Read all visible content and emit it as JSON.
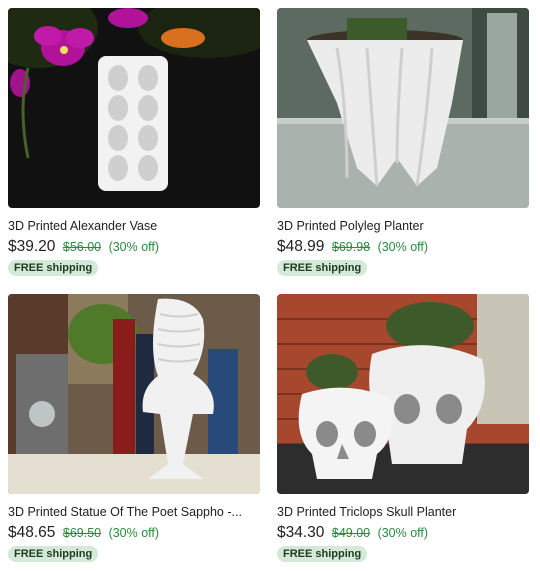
{
  "listings": [
    {
      "title": "3D Printed Alexander Vase",
      "price": "$39.20",
      "original_price": "$56.00",
      "discount": "(30% off)",
      "shipping_badge": "FREE shipping"
    },
    {
      "title": "3D Printed Polyleg Planter",
      "price": "$48.99",
      "original_price": "$69.98",
      "discount": "(30% off)",
      "shipping_badge": "FREE shipping"
    },
    {
      "title": "3D Printed Statue Of The Poet Sappho -...",
      "price": "$48.65",
      "original_price": "$69.50",
      "discount": "(30% off)",
      "shipping_badge": "FREE shipping"
    },
    {
      "title": "3D Printed Triclops Skull Planter",
      "price": "$34.30",
      "original_price": "$49.00",
      "discount": "(30% off)",
      "shipping_badge": "FREE shipping"
    }
  ],
  "colors": {
    "sale_green": "#2b8a3e",
    "badge_bg": "#d4e9d7",
    "text": "#222222"
  }
}
